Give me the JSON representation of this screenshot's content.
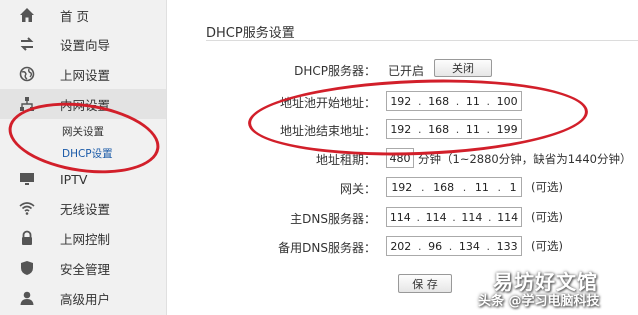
{
  "sidebar": {
    "items": [
      {
        "icon": "home-icon",
        "label": "首  页"
      },
      {
        "icon": "setup-wizard-icon",
        "label": "设置向导"
      },
      {
        "icon": "globe-icon",
        "label": "上网设置"
      },
      {
        "icon": "lan-icon",
        "label": "内网设置"
      },
      {
        "icon": "monitor-icon",
        "label": "IPTV"
      },
      {
        "icon": "wifi-icon",
        "label": "无线设置"
      },
      {
        "icon": "lock-icon",
        "label": "上网控制"
      },
      {
        "icon": "shield-icon",
        "label": "安全管理"
      },
      {
        "icon": "user-icon",
        "label": "高级用户"
      }
    ],
    "subitems": [
      {
        "label": "网关设置"
      },
      {
        "label": "DHCP设置"
      }
    ]
  },
  "panel": {
    "title": "DHCP服务设置",
    "dhcp_server_label": "DHCP服务器：",
    "dhcp_server_status": "已开启",
    "toggle_button": "关闭",
    "pool_start_label": "地址池开始地址：",
    "pool_start_ip": [
      "192",
      "168",
      "11",
      "100"
    ],
    "pool_end_label": "地址池结束地址：",
    "pool_end_ip": [
      "192",
      "168",
      "11",
      "199"
    ],
    "lease_label": "地址租期：",
    "lease_value": "480",
    "lease_hint": "分钟（1~2880分钟，缺省为1440分钟）",
    "gateway_label": "网关：",
    "gateway_ip": [
      "192",
      "168",
      "11",
      "1"
    ],
    "primary_dns_label": "主DNS服务器：",
    "primary_dns_ip": [
      "114",
      "114",
      "114",
      "114"
    ],
    "secondary_dns_label": "备用DNS服务器：",
    "secondary_dns_ip": [
      "202",
      "96",
      "134",
      "133"
    ],
    "optional": "(可选)",
    "save_button": "保 存"
  },
  "watermark": {
    "line1": "易坊好文馆",
    "line2": "头条 @学习电脑科技"
  },
  "colors": {
    "annotation": "#d21f2a",
    "selected_link": "#1a5aa8"
  }
}
